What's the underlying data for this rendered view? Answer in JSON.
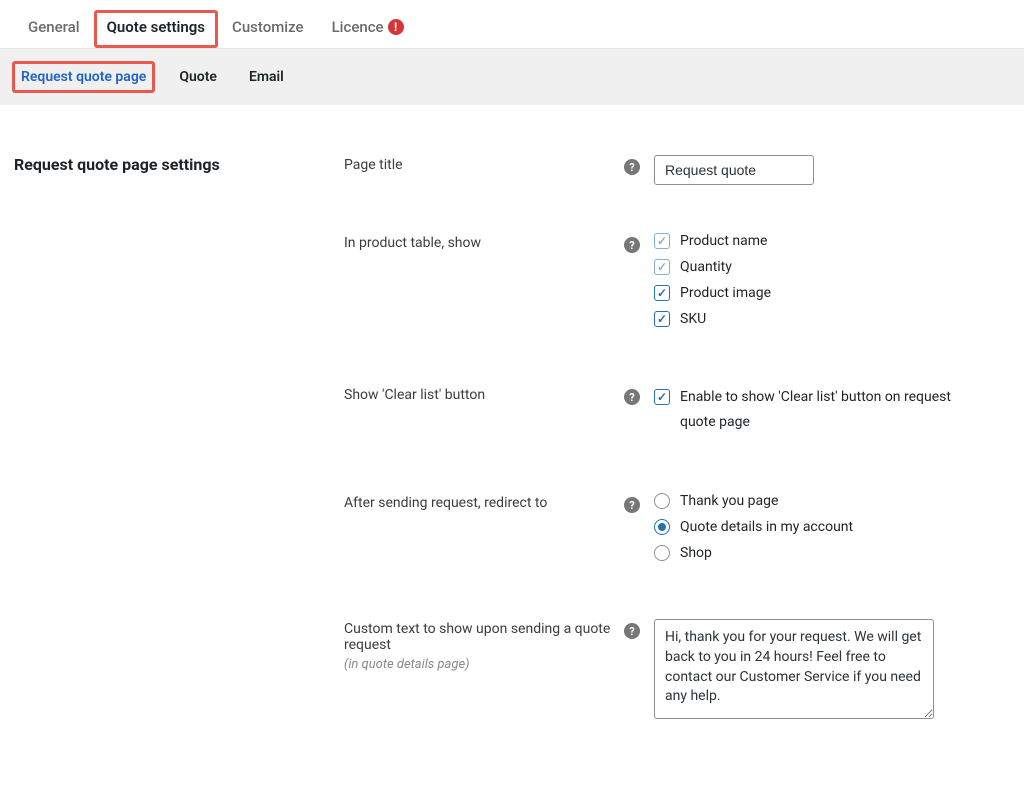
{
  "tabs": {
    "general": "General",
    "quote_settings": "Quote settings",
    "customize": "Customize",
    "licence": "Licence"
  },
  "subtabs": {
    "request_quote_page": "Request quote page",
    "quote": "Quote",
    "email": "Email"
  },
  "section_title": "Request quote page settings",
  "fields": {
    "page_title": {
      "label": "Page title",
      "value": "Request quote"
    },
    "in_product_table": {
      "label": "In product table, show",
      "options": {
        "product_name": "Product name",
        "quantity": "Quantity",
        "product_image": "Product image",
        "sku": "SKU"
      }
    },
    "show_clear_list": {
      "label": "Show 'Clear list' button",
      "option": "Enable to show 'Clear list' button on request quote page"
    },
    "redirect": {
      "label": "After sending request, redirect to",
      "options": {
        "thank_you": "Thank you page",
        "quote_details": "Quote details in my account",
        "shop": "Shop"
      }
    },
    "custom_text": {
      "label": "Custom text to show upon sending a quote request",
      "hint": "(in quote details page)",
      "value": "Hi, thank you for your request. We will get back to you in 24 hours! Feel free to contact our Customer Service if you need any help."
    }
  },
  "icons": {
    "help": "?",
    "alert": "!"
  }
}
